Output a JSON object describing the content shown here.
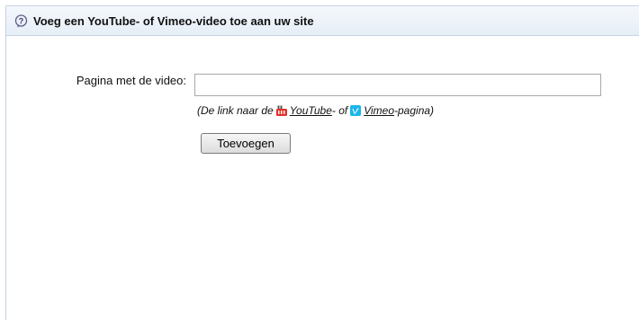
{
  "panel": {
    "title": "Voeg een YouTube- of Vimeo-video toe aan uw site",
    "icon": "help-question-icon"
  },
  "form": {
    "field_label": "Pagina met de video:",
    "url_value": "",
    "url_placeholder": "",
    "hint": {
      "prefix": "(De link naar de ",
      "youtube_label": "YouTube",
      "middle": "- of ",
      "vimeo_label": "Vimeo",
      "suffix": "-pagina)"
    },
    "submit_label": "Toevoegen"
  },
  "colors": {
    "border": "#c5d3e3",
    "header_bg": "#e6eef6",
    "youtube_red": "#e52d27",
    "vimeo_blue": "#1ab7ea"
  }
}
